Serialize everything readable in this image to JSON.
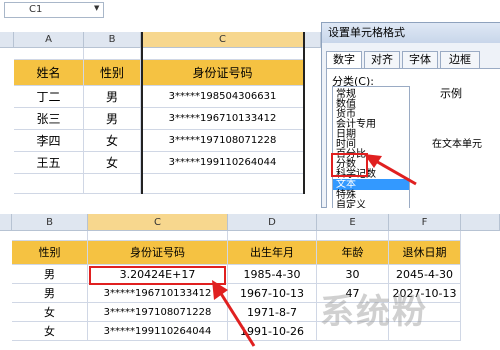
{
  "top_sheet": {
    "namebox": "C1",
    "columns": [
      "A",
      "B",
      "C"
    ],
    "header": [
      "姓名",
      "性别",
      "身份证号码"
    ],
    "rows": [
      [
        "丁二",
        "男",
        "3*****198504306631"
      ],
      [
        "张三",
        "男",
        "3*****196710133412"
      ],
      [
        "李四",
        "女",
        "3*****197108071228"
      ],
      [
        "王五",
        "女",
        "3*****199110264044"
      ]
    ]
  },
  "dialog": {
    "title": "设置单元格格式",
    "tabs": [
      "数字",
      "对齐",
      "字体",
      "边框"
    ],
    "category_label": "分类(C):",
    "categories": [
      "常规",
      "数值",
      "货币",
      "会计专用",
      "日期",
      "时间",
      "百分比",
      "分数",
      "科学记数",
      "文本",
      "特殊",
      "自定义"
    ],
    "selected_category": "文本",
    "example_label": "示例",
    "text_description": "在文本单元"
  },
  "bottom_sheet": {
    "columns": [
      "B",
      "C",
      "D",
      "E",
      "F"
    ],
    "header": [
      "性别",
      "身份证号码",
      "出生年月",
      "年龄",
      "退休日期"
    ],
    "rows": [
      [
        "男",
        "3.20424E+17",
        "1985-4-30",
        "30",
        "2045-4-30"
      ],
      [
        "男",
        "3*****196710133412",
        "1967-10-13",
        "47",
        "2027-10-13"
      ],
      [
        "女",
        "3*****197108071228",
        "1971-8-7",
        "",
        ""
      ],
      [
        "女",
        "3*****199110264044",
        "1991-10-26",
        "",
        ""
      ]
    ]
  },
  "watermark": "系统粉",
  "colors": {
    "header_fill": "#f5c242",
    "highlight": "#e02020",
    "selected_item": "#3399ff"
  }
}
